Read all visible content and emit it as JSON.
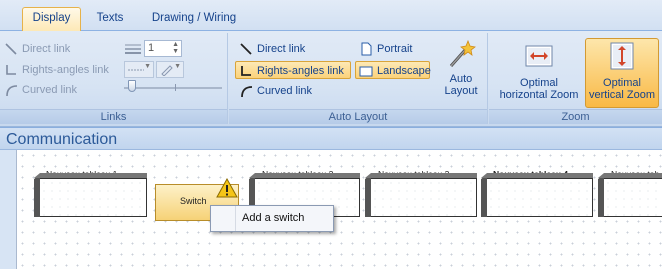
{
  "tabs": [
    "Display",
    "Texts",
    "Drawing / Wiring"
  ],
  "links_group": {
    "label": "Links",
    "direct_link": "Direct link",
    "rights_angles_link": "Rights-angles link",
    "curved_link": "Curved link",
    "spin_value": "1"
  },
  "auto_layout_group": {
    "label": "Auto Layout",
    "direct_link": "Direct link",
    "rights_angles_link": "Rights-angles link",
    "curved_link": "Curved link",
    "portrait": "Portrait",
    "landscape": "Landscape",
    "auto_layout_line1": "Auto",
    "auto_layout_line2": "Layout"
  },
  "zoom_group": {
    "label": "Zoom",
    "optimal_h_line1": "Optimal",
    "optimal_h_line2": "horizontal Zoom",
    "optimal_v_line1": "Optimal",
    "optimal_v_line2": "vertical Zoom"
  },
  "panel": {
    "title": "Communication"
  },
  "tables": [
    "Nouveau tableau 1",
    "Nouveau tableau 2",
    "Nouveau tableau 3",
    "Nouveau tableau 4",
    "Nouveau tab"
  ],
  "switch_label": "Switch",
  "context_menu": {
    "add_switch": "Add a switch"
  },
  "colors": {
    "selection": "#fbd27a",
    "ribbon": "#d6e3f3",
    "accent": "#15428b"
  }
}
